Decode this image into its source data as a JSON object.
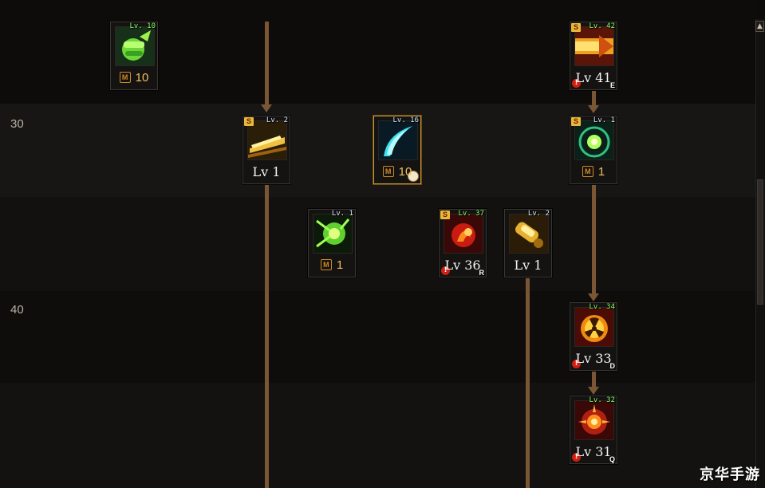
{
  "row_labels": [
    "30",
    "40"
  ],
  "watermark": "京华手游",
  "scrollbar": {
    "up_icon": "▲"
  },
  "skills": [
    {
      "id": "s1",
      "level_tag": "Lv. 10",
      "badge": "",
      "bottom_type": "m",
      "bottom": "10",
      "icon": "green-fist",
      "warn": false,
      "key": ""
    },
    {
      "id": "s2",
      "level_tag": "Lv. 42",
      "badge": "S",
      "bottom_type": "lv",
      "bottom": "Lv 41",
      "icon": "orange-beam",
      "warn": true,
      "key": "E"
    },
    {
      "id": "s3",
      "level_tag": "Lv. 2",
      "badge": "S",
      "bottom_type": "lv",
      "bottom": "Lv 1",
      "icon": "gold-blade",
      "warn": false,
      "key": ""
    },
    {
      "id": "s4",
      "level_tag": "Lv. 16",
      "badge": "",
      "bottom_type": "m",
      "bottom": "10",
      "icon": "cyan-slash",
      "warn": false,
      "key": "",
      "clock": true
    },
    {
      "id": "s5",
      "level_tag": "Lv. 1",
      "badge": "S",
      "bottom_type": "m",
      "bottom": "1",
      "icon": "green-orb",
      "warn": false,
      "key": ""
    },
    {
      "id": "s6",
      "level_tag": "Lv. 1",
      "badge": "",
      "bottom_type": "m",
      "bottom": "1",
      "icon": "green-burst",
      "warn": false,
      "key": ""
    },
    {
      "id": "s7",
      "level_tag": "Lv. 37",
      "badge": "S",
      "bottom_type": "lv",
      "bottom": "Lv 36",
      "icon": "red-flame",
      "warn": true,
      "key": "R"
    },
    {
      "id": "s8",
      "level_tag": "Lv. 2",
      "badge": "",
      "bottom_type": "lv",
      "bottom": "Lv 1",
      "icon": "gold-cannon",
      "warn": false,
      "key": ""
    },
    {
      "id": "s9",
      "level_tag": "Lv. 34",
      "badge": "",
      "bottom_type": "lv",
      "bottom": "Lv 33",
      "icon": "radiation",
      "warn": true,
      "key": "D"
    },
    {
      "id": "s10",
      "level_tag": "Lv. 32",
      "badge": "",
      "bottom_type": "lv",
      "bottom": "Lv 31",
      "icon": "sun-blast",
      "warn": true,
      "key": "Q"
    }
  ]
}
